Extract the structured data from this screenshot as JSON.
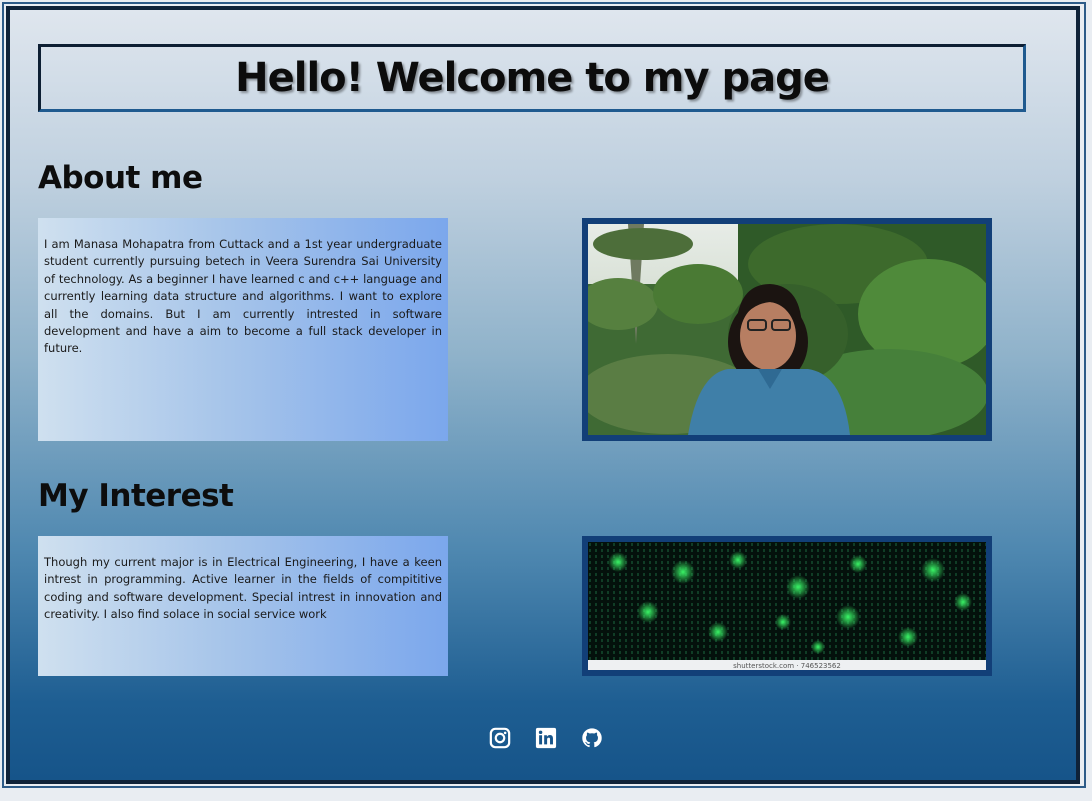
{
  "header": {
    "title": "Hello! Welcome to my page"
  },
  "about": {
    "heading": "About me",
    "text": "I am Manasa Mohapatra from Cuttack and a 1st year undergraduate student currently pursuing betech in Veera Surendra Sai University of technology. As a beginner I have learned c and c++ language and currently learning data structure and algorithms. I want to explore all the domains. But I am currently intrested in software development and have a aim to become a full stack developer in future."
  },
  "interest": {
    "heading": "My Interest",
    "text": "Though my current major is in Electrical Engineering, I have a keen intrest in programming. Active learner in the fields of compititive coding and software development. Special intrest in innovation and creativity. I also find solace in social service work",
    "image_caption": "shutterstock.com · 746523562"
  },
  "social": {
    "icons": [
      "instagram-icon",
      "linkedin-icon",
      "github-icon"
    ]
  },
  "colors": {
    "frame_border": "#0f2238",
    "image_border": "#123f78",
    "text_box_gradient_end": "#7ba7ec"
  }
}
